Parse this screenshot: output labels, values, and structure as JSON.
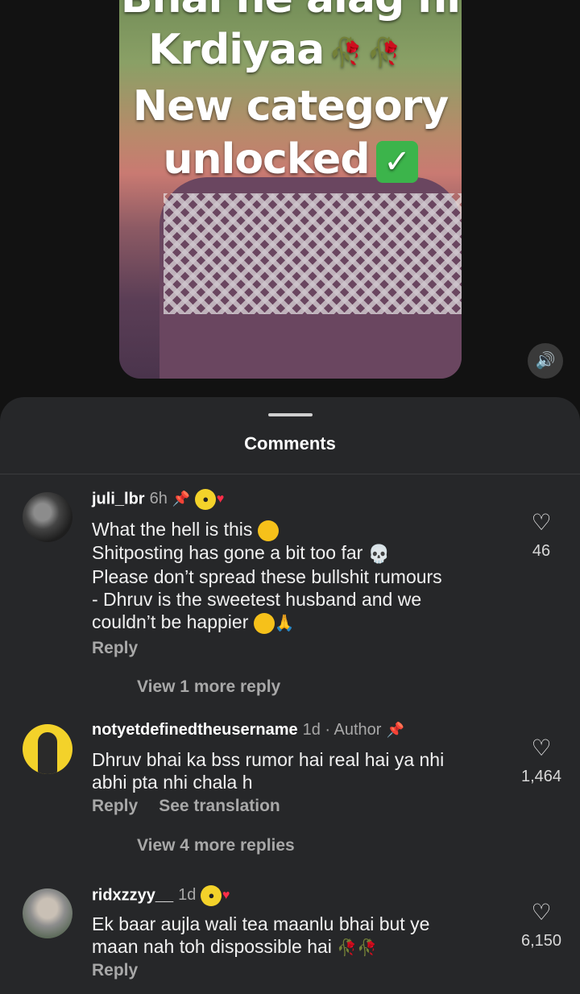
{
  "video": {
    "overlay_lines": [
      "Bhai ne alag hi",
      "Krdiyaa",
      "New category",
      "unlocked"
    ]
  },
  "sheet": {
    "title": "Comments"
  },
  "comments": [
    {
      "username": "juli_lbr",
      "time": "6h",
      "pinned": true,
      "lines": [
        "What the hell is this",
        "Shitposting has gone a bit too far",
        "Please don’t spread these bullshit rumours",
        "- Dhruv is the sweetest husband and we",
        "couldn’t be happier"
      ],
      "reply_label": "Reply",
      "view_more": "View 1 more reply",
      "likes": "46"
    },
    {
      "username": "notyetdefinedtheusername",
      "time": "1d",
      "author_label": "Author",
      "pinned": true,
      "lines": [
        "Dhruv bhai ka bss rumor hai real hai ya nhi",
        "abhi pta nhi chala h"
      ],
      "reply_label": "Reply",
      "translate_label": "See translation",
      "view_more": "View 4 more replies",
      "likes": "1,464"
    },
    {
      "username": "ridxzzyy__",
      "time": "1d",
      "lines": [
        "Ek baar aujla wali tea maanlu bhai but ye",
        "maan nah toh dispossible hai"
      ],
      "reply_label": "Reply",
      "likes": "6,150"
    }
  ],
  "icons": {
    "sound": "speaker-icon",
    "like": "heart-icon",
    "pin": "pin-icon"
  }
}
